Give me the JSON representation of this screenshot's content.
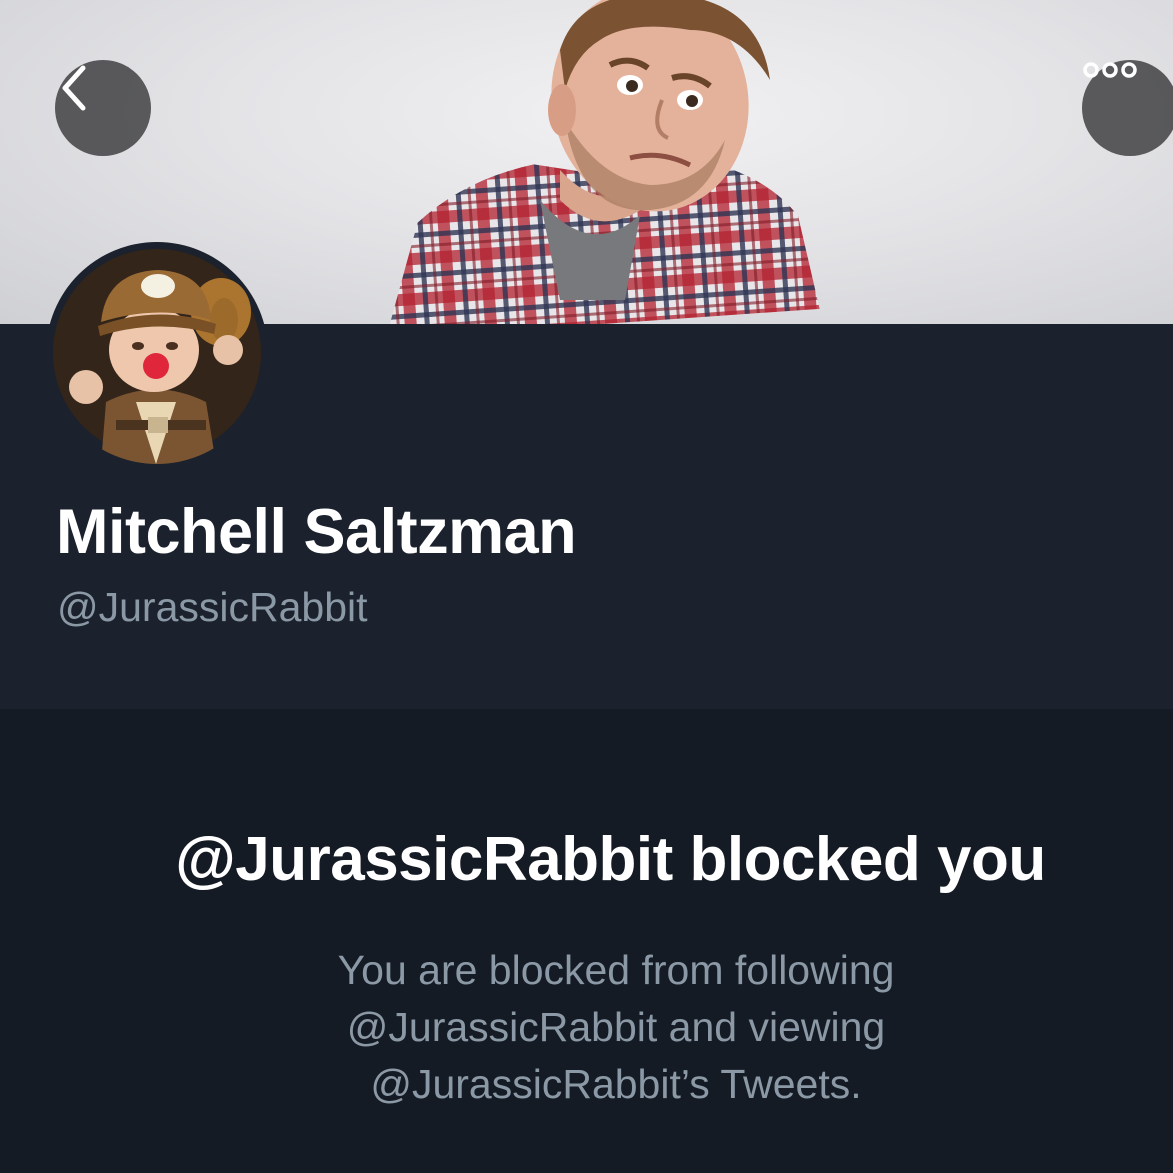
{
  "profile": {
    "display_name": "Mitchell Saltzman",
    "handle": "@JurassicRabbit"
  },
  "header": {
    "back_icon": "chevron-left-icon",
    "more_icon": "more-horizontal-icon"
  },
  "blocked": {
    "title": "@JurassicRabbit blocked you",
    "message": "You are blocked from following @JurassicRabbit and viewing @JurassicRabbit’s Tweets."
  },
  "colors": {
    "background": "#151b24",
    "profile_panel": "#1b222d",
    "secondary_text": "#8b98a5",
    "primary_text": "#ffffff"
  }
}
